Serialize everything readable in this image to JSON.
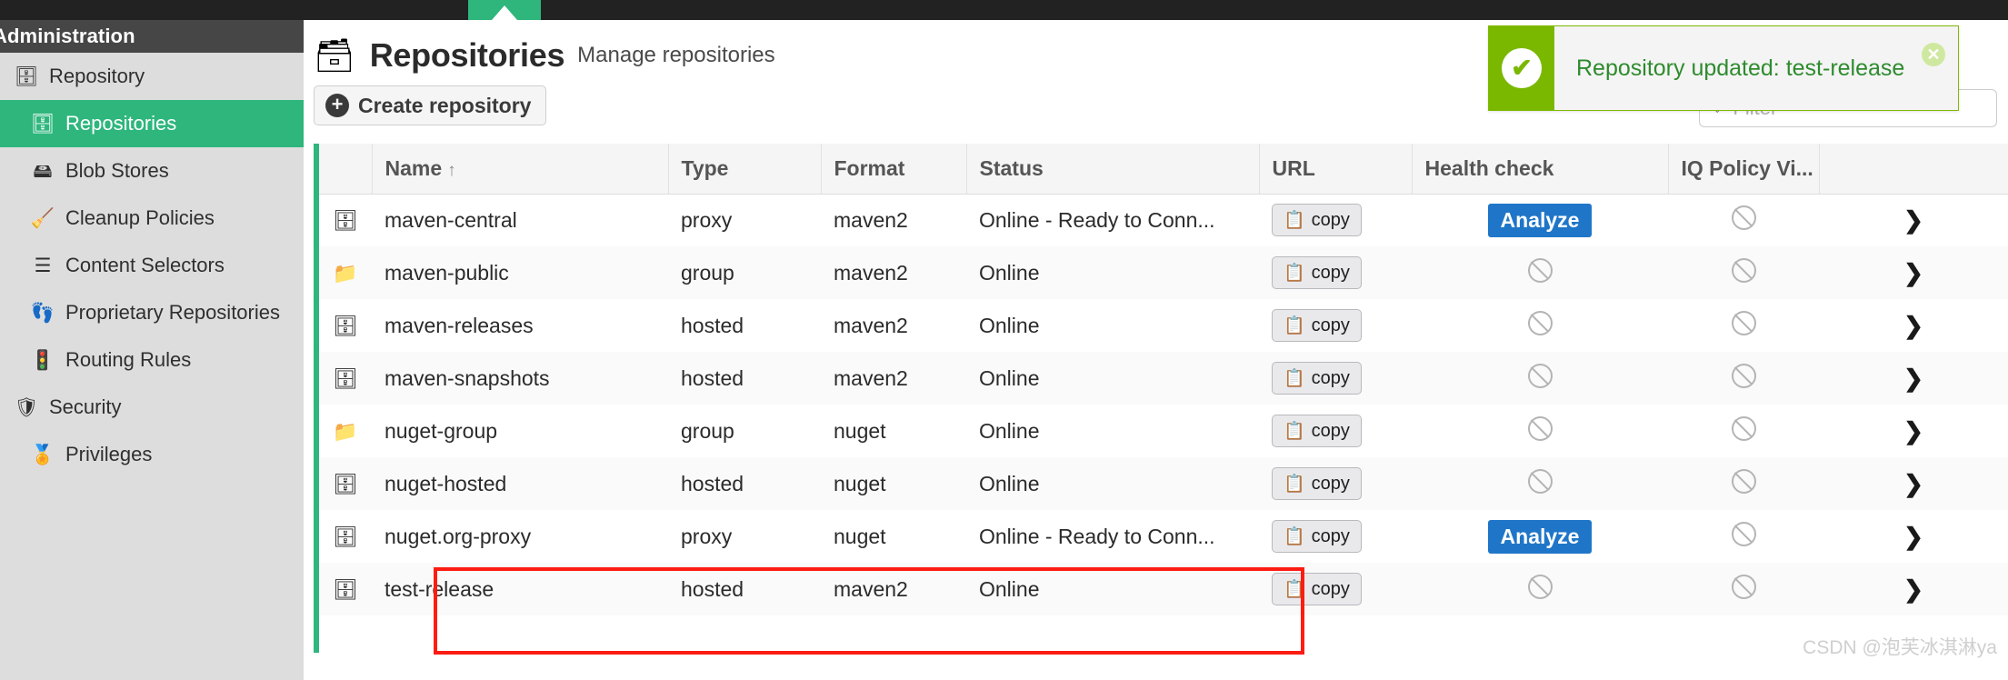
{
  "topbar": {
    "tab_label": ""
  },
  "sidebar": {
    "header_title": "Administration",
    "items": [
      {
        "label": "Repository",
        "icon": "database-icon",
        "level": "group",
        "caret": "▾",
        "glyph": "🗄",
        "active": false
      },
      {
        "label": "Repositories",
        "icon": "database-icon",
        "level": "child",
        "caret": "",
        "glyph": "🗄",
        "active": true
      },
      {
        "label": "Blob Stores",
        "icon": "blob-store-icon",
        "level": "child",
        "caret": "",
        "glyph": "🖴",
        "active": false
      },
      {
        "label": "Cleanup Policies",
        "icon": "broom-icon",
        "level": "child",
        "caret": "",
        "glyph": "🧹",
        "active": false
      },
      {
        "label": "Content Selectors",
        "icon": "layers-icon",
        "level": "child",
        "caret": "",
        "glyph": "☰",
        "active": false
      },
      {
        "label": "Proprietary Repositories",
        "icon": "footprints-icon",
        "level": "child",
        "caret": "",
        "glyph": "👣",
        "active": false
      },
      {
        "label": "Routing Rules",
        "icon": "signpost-icon",
        "level": "child",
        "caret": "",
        "glyph": "🚦",
        "active": false
      },
      {
        "label": "Security",
        "icon": "shield-icon",
        "level": "group",
        "caret": "▾",
        "glyph": "🛡",
        "active": false
      },
      {
        "label": "Privileges",
        "icon": "medal-icon",
        "level": "child",
        "caret": "",
        "glyph": "🏅",
        "active": false
      }
    ]
  },
  "page": {
    "icon": "database-icon",
    "title": "Repositories",
    "subtitle": "Manage repositories"
  },
  "toolbar": {
    "create_label": "Create repository",
    "create_icon": "plus-circle-icon",
    "filter_icon": "funnel-icon",
    "filter_value": "",
    "filter_placeholder": "Filter"
  },
  "toast": {
    "message": "Repository updated: test-release",
    "icon": "check-circle-icon",
    "close_icon": "close-icon",
    "accent_color": "#7ab800",
    "text_color": "#2e8b2e"
  },
  "table": {
    "columns": [
      {
        "key": "cb",
        "label": ""
      },
      {
        "key": "name",
        "label": "Name",
        "sort": "↑"
      },
      {
        "key": "type",
        "label": "Type"
      },
      {
        "key": "format",
        "label": "Format"
      },
      {
        "key": "status",
        "label": "Status"
      },
      {
        "key": "url",
        "label": "URL"
      },
      {
        "key": "health",
        "label": "Health check"
      },
      {
        "key": "iq",
        "label": "IQ Policy Vi..."
      },
      {
        "key": "more",
        "label": ""
      }
    ],
    "copy_label": "copy",
    "copy_icon": "clipboard-icon",
    "analyze_label": "Analyze",
    "ban_icon": "ban-icon",
    "chevron_icon": "chevron-right-icon",
    "rows": [
      {
        "icon": "repo-proxy-icon",
        "glyph": "🗄",
        "name": "maven-central",
        "type": "proxy",
        "format": "maven2",
        "status": "Online - Ready to Conn...",
        "url": "copy",
        "health": "analyze",
        "iq": "ban"
      },
      {
        "icon": "repo-group-icon",
        "glyph": "📁",
        "name": "maven-public",
        "type": "group",
        "format": "maven2",
        "status": "Online",
        "url": "copy",
        "health": "ban",
        "iq": "ban"
      },
      {
        "icon": "repo-hosted-icon",
        "glyph": "🗄",
        "name": "maven-releases",
        "type": "hosted",
        "format": "maven2",
        "status": "Online",
        "url": "copy",
        "health": "ban",
        "iq": "ban"
      },
      {
        "icon": "repo-hosted-icon",
        "glyph": "🗄",
        "name": "maven-snapshots",
        "type": "hosted",
        "format": "maven2",
        "status": "Online",
        "url": "copy",
        "health": "ban",
        "iq": "ban"
      },
      {
        "icon": "repo-group-icon",
        "glyph": "📁",
        "name": "nuget-group",
        "type": "group",
        "format": "nuget",
        "status": "Online",
        "url": "copy",
        "health": "ban",
        "iq": "ban"
      },
      {
        "icon": "repo-hosted-icon",
        "glyph": "🗄",
        "name": "nuget-hosted",
        "type": "hosted",
        "format": "nuget",
        "status": "Online",
        "url": "copy",
        "health": "ban",
        "iq": "ban"
      },
      {
        "icon": "repo-proxy-icon",
        "glyph": "🗄",
        "name": "nuget.org-proxy",
        "type": "proxy",
        "format": "nuget",
        "status": "Online - Ready to Conn...",
        "url": "copy",
        "health": "analyze",
        "iq": "ban"
      },
      {
        "icon": "repo-hosted-icon",
        "glyph": "🗄",
        "name": "test-release",
        "type": "hosted",
        "format": "maven2",
        "status": "Online",
        "url": "copy",
        "health": "ban",
        "iq": "ban"
      }
    ]
  },
  "annotation": {
    "highlight_color": "#fc1c12"
  },
  "watermark": {
    "text": "CSDN @泡芙冰淇淋ya"
  }
}
